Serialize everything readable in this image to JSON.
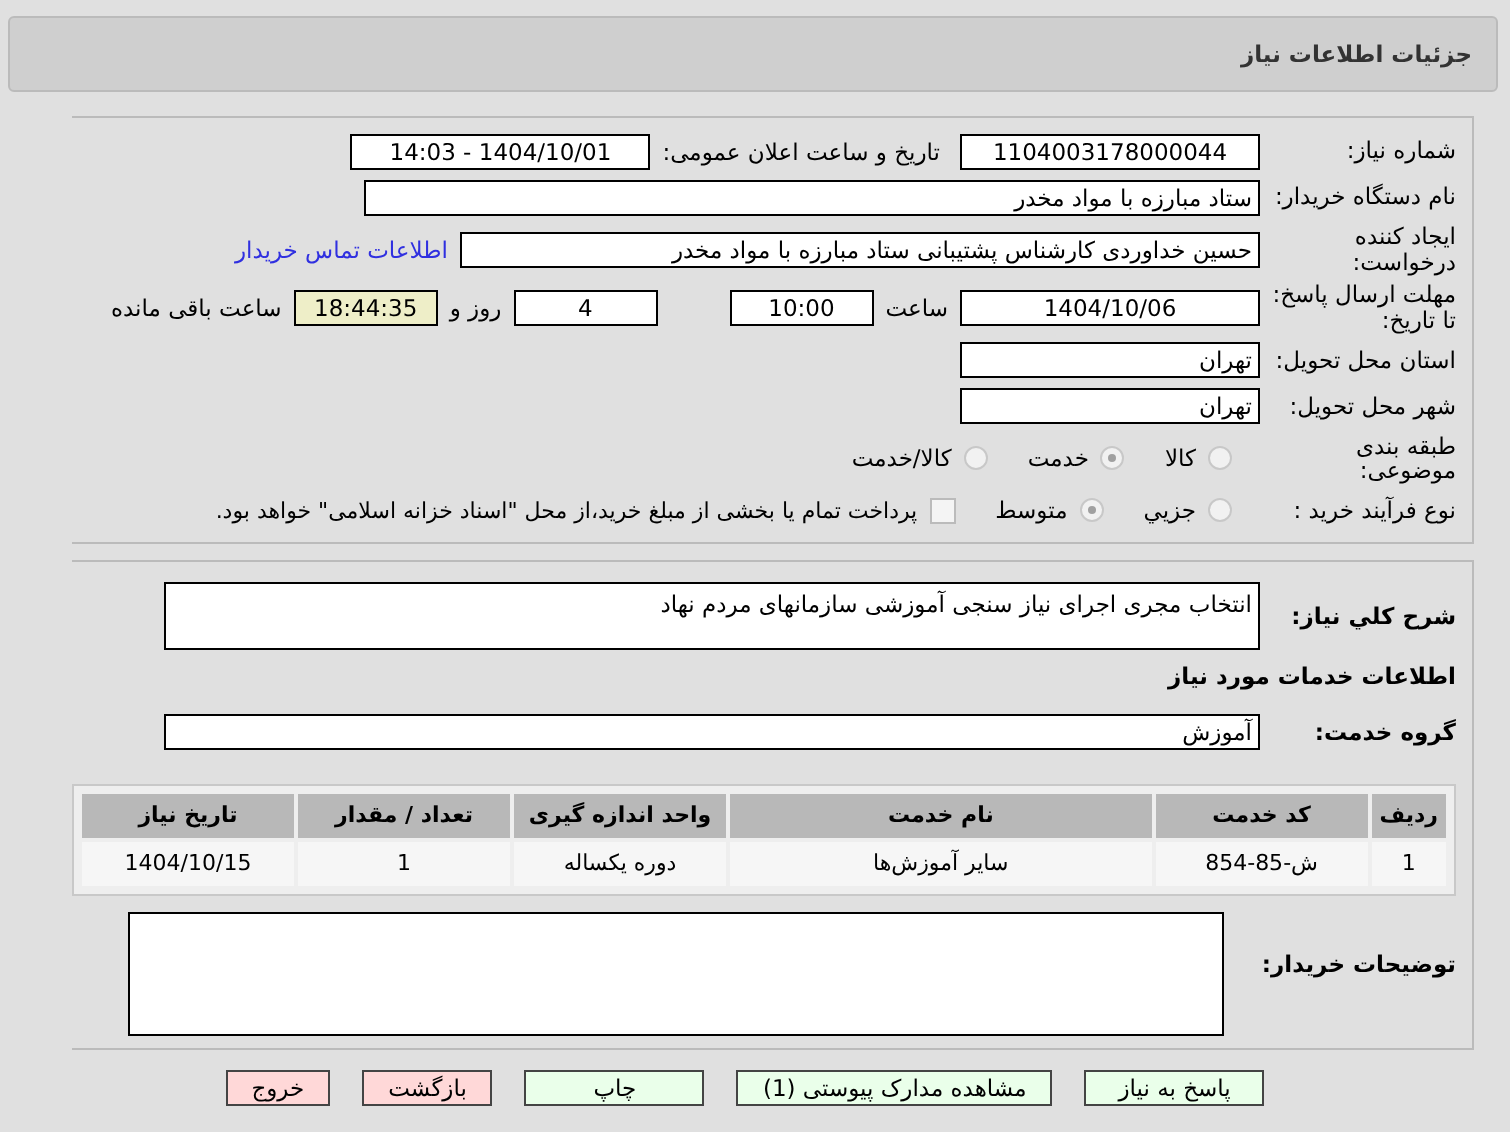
{
  "window": {
    "title": "جزئیات اطلاعات نیاز"
  },
  "need_number": {
    "label": "شماره نیاز:",
    "value": "1104003178000044"
  },
  "announce": {
    "label": "تاریخ و ساعت اعلان عمومی:",
    "value": "1404/10/01 - 14:03"
  },
  "buyer_org": {
    "label": "نام دستگاه خریدار:",
    "value": "ستاد مبارزه با مواد مخدر"
  },
  "requester": {
    "label": "ایجاد کننده درخواست:",
    "value": "حسین  خداوردی  کارشناس پشتیبانی ستاد مبارزه با مواد مخدر",
    "link": "اطلاعات تماس خریدار"
  },
  "deadline": {
    "label": "مهلت ارسال پاسخ: تا تاریخ:",
    "date": "1404/10/06",
    "time_label": "ساعت",
    "time": "10:00",
    "days": "4",
    "days_label": "روز و",
    "remaining": "18:44:35",
    "remaining_label": "ساعت باقی مانده"
  },
  "province": {
    "label": "استان محل تحویل:",
    "value": "تهران"
  },
  "city": {
    "label": "شهر محل تحویل:",
    "value": "تهران"
  },
  "category": {
    "label": "طبقه بندی موضوعی:",
    "options": [
      {
        "label": "کالا",
        "selected": false
      },
      {
        "label": "خدمت",
        "selected": true
      },
      {
        "label": "کالا/خدمت",
        "selected": false
      }
    ]
  },
  "process": {
    "label": "نوع فرآیند خرید :",
    "options": [
      {
        "label": "جزیي",
        "selected": false
      },
      {
        "label": "متوسط",
        "selected": true
      }
    ],
    "checkbox": {
      "checked": false,
      "text": "پرداخت تمام یا بخشی از مبلغ خرید،از محل \"اسناد خزانه اسلامی\" خواهد بود."
    }
  },
  "summary": {
    "label": "شرح کلي نیاز:",
    "value": "انتخاب مجری اجرای نیاز سنجی آموزشی سازمانهای مردم نهاد"
  },
  "services_heading": "اطلاعات خدمات مورد نیاز",
  "service_group": {
    "label": "گروه خدمت:",
    "value": "آموزش"
  },
  "table": {
    "columns": [
      "ردیف",
      "کد خدمت",
      "نام خدمت",
      "واحد اندازه گیری",
      "تعداد / مقدار",
      "تاریخ نیاز"
    ],
    "rows": [
      [
        "1",
        "ش-85-854",
        "سایر آموزش‌ها",
        "دوره یکساله",
        "1",
        "1404/10/15"
      ]
    ]
  },
  "buyer_notes": {
    "label": "توضیحات خریدار:"
  },
  "buttons": [
    {
      "label": "پاسخ به نیاز",
      "kind": "action"
    },
    {
      "label": "مشاهده مدارک پیوستی (1)",
      "kind": "action"
    },
    {
      "label": "چاپ",
      "kind": "action"
    },
    {
      "label": "بازگشت",
      "kind": "nav"
    },
    {
      "label": "خروج",
      "kind": "nav"
    }
  ]
}
